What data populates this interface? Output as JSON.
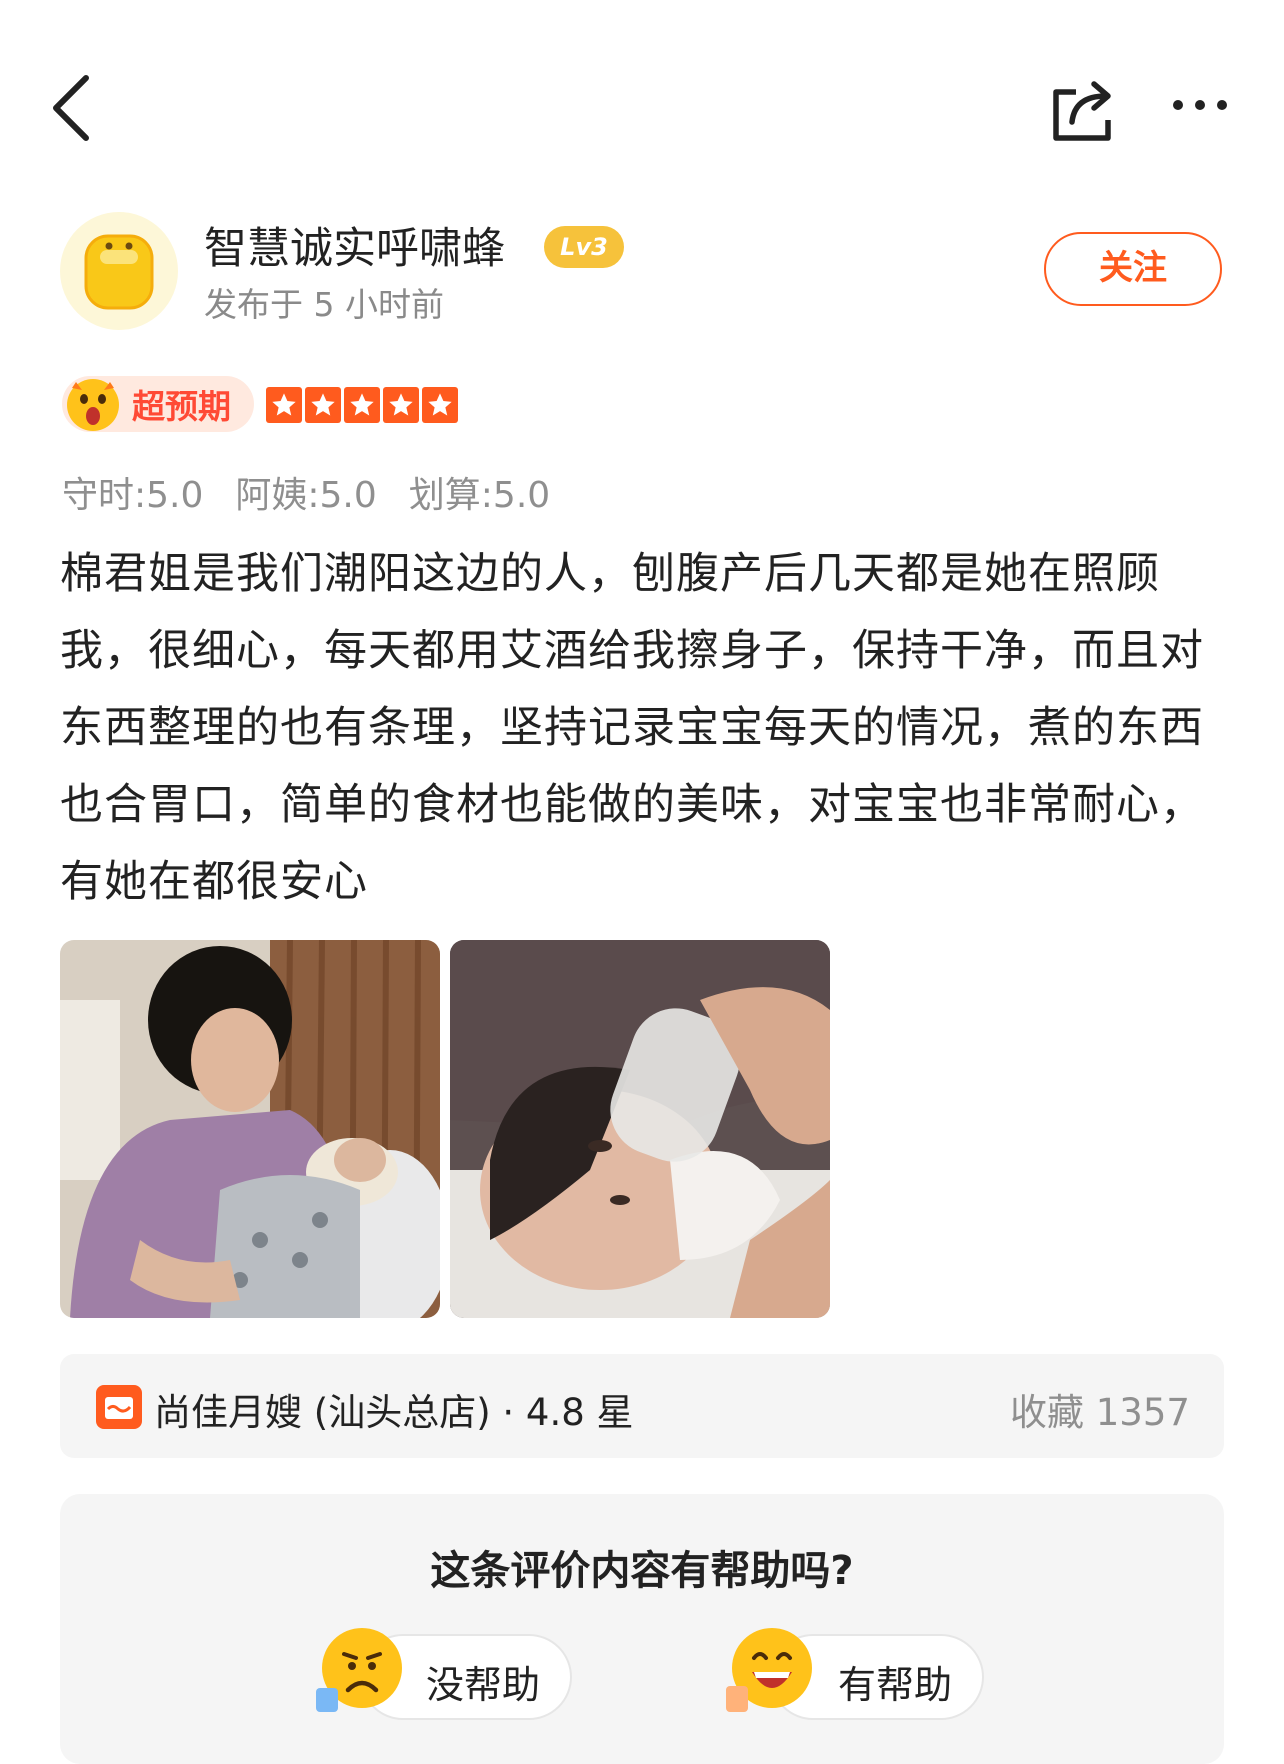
{
  "nav": {
    "back_icon": "chevron-left-icon",
    "share_icon": "share-icon",
    "more_icon": "more-icon"
  },
  "author": {
    "name": "智慧诚实呼啸蜂",
    "level": "Lv3",
    "posted": "发布于 5 小时前",
    "follow_label": "关注"
  },
  "rating": {
    "label": "超预期",
    "stars": 5,
    "sub_scores": [
      {
        "text": "守时:5.0"
      },
      {
        "text": "阿姨:5.0"
      },
      {
        "text": "划算:5.0"
      }
    ]
  },
  "review": {
    "text": "棉君姐是我们潮阳这边的人，刨腹产后几天都是她在照顾我，很细心，每天都用艾酒给我擦身子，保持干净，而且对东西整理的也有条理，坚持记录宝宝每天的情况，煮的东西也合胃口，简单的食材也能做的美味，对宝宝也非常耐心，有她在都很安心"
  },
  "shop": {
    "name": "尚佳月嫂 (汕头总店) · 4.8 星",
    "favorites": "收藏 1357"
  },
  "helpful": {
    "question": "这条评价内容有帮助吗?",
    "no_label": "没帮助",
    "yes_label": "有帮助"
  },
  "colors": {
    "accent": "#ff5b1e",
    "badge_gold": "#f6c23b"
  }
}
